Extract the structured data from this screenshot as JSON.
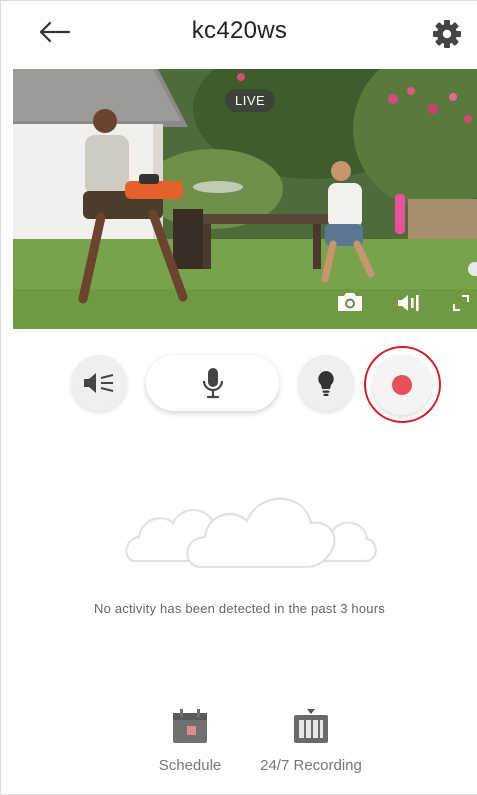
{
  "header": {
    "title": "kc420ws",
    "back_icon": "arrow-left-icon",
    "settings_icon": "gear-icon"
  },
  "video": {
    "live_label": "LIVE",
    "snapshot_icon": "camera-icon",
    "sound_icon": "speaker-icon",
    "fullscreen_icon": "expand-icon"
  },
  "controls": {
    "mute_icon": "speaker-mute-icon",
    "talk_icon": "microphone-icon",
    "light_icon": "bulb-icon",
    "record_icon": "record-dot-icon",
    "record_color": "#e6505a",
    "highlight_color": "#d31d24"
  },
  "empty_state": {
    "icon": "cloud-icon",
    "message": "No activity has been detected in the past 3 hours"
  },
  "nav": {
    "items": [
      {
        "label": "Schedule",
        "icon": "calendar-icon"
      },
      {
        "label": "24/7 Recording",
        "icon": "recording-icon"
      }
    ]
  }
}
